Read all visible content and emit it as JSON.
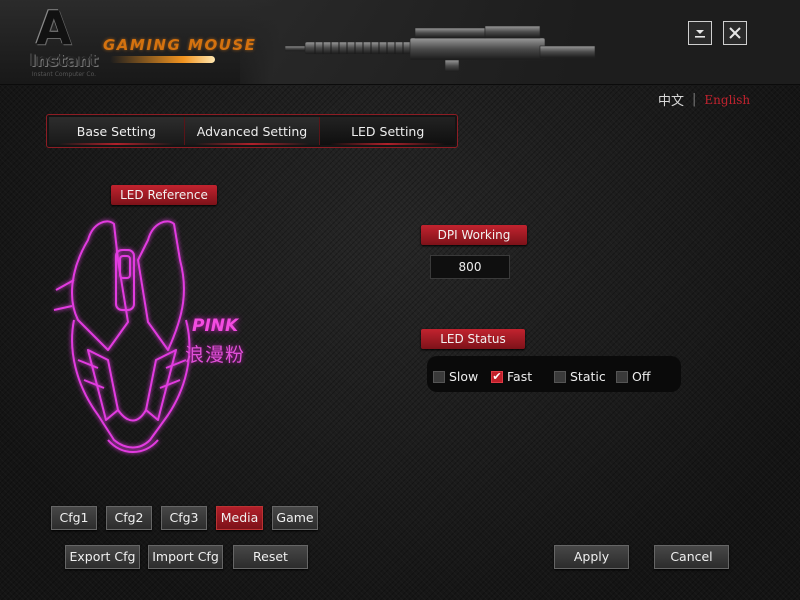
{
  "header": {
    "logo_mark": "A",
    "brand": "Instant",
    "brand_tagline": "Instant Computer Co.",
    "product_title": "GAMING MOUSE",
    "minimize_icon": "minimize-icon",
    "close_icon": "close-icon"
  },
  "language": {
    "chinese": "中文",
    "separator": "|",
    "english": "English",
    "selected": "English"
  },
  "tabs": [
    {
      "label": "Base Setting"
    },
    {
      "label": "Advanced Setting"
    },
    {
      "label": "LED Setting"
    }
  ],
  "active_tab": "LED Setting",
  "led_reference": {
    "label": "LED Reference",
    "color_name": "PINK",
    "color_name_cn": "浪漫粉",
    "led_color": "#e23be0"
  },
  "dpi": {
    "label": "DPI Working",
    "value": "800"
  },
  "led_status": {
    "label": "LED Status",
    "options": [
      {
        "label": "Slow",
        "checked": false
      },
      {
        "label": "Fast",
        "checked": true
      },
      {
        "label": "Static",
        "checked": false
      },
      {
        "label": "Off",
        "checked": false
      }
    ]
  },
  "configs": {
    "cfg1": "Cfg1",
    "cfg2": "Cfg2",
    "cfg3": "Cfg3",
    "media": "Media",
    "game": "Game",
    "selected": "Media"
  },
  "actions": {
    "export": "Export Cfg",
    "import": "Import Cfg",
    "reset": "Reset",
    "apply": "Apply",
    "cancel": "Cancel"
  },
  "colors": {
    "accent": "#b11f2a",
    "background": "#1a1a1a",
    "title_orange": "#d4720f"
  }
}
